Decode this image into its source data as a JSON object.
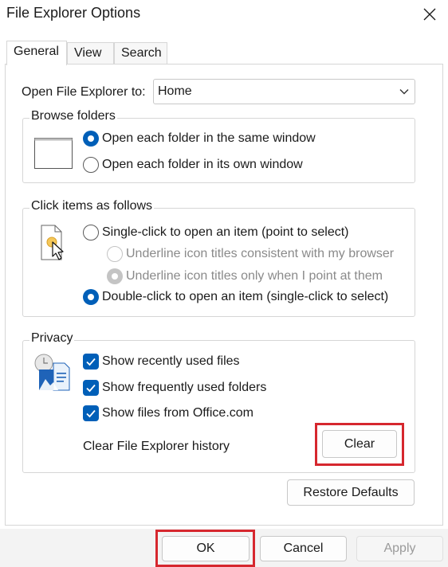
{
  "window": {
    "title": "File Explorer Options",
    "close_icon": "close-icon"
  },
  "tabs": [
    {
      "label": "General",
      "active": true
    },
    {
      "label": "View",
      "active": false
    },
    {
      "label": "Search",
      "active": false
    }
  ],
  "open_to": {
    "label": "Open File Explorer to:",
    "value": "Home"
  },
  "browse_folders": {
    "title": "Browse folders",
    "icon": "window-icon",
    "options": [
      {
        "label": "Open each folder in the same window",
        "checked": true
      },
      {
        "label": "Open each folder in its own window",
        "checked": false
      }
    ]
  },
  "click_items": {
    "title": "Click items as follows",
    "icon": "pointer-file-icon",
    "options": [
      {
        "label": "Single-click to open an item (point to select)",
        "checked": false
      },
      {
        "label": "Underline icon titles consistent with my browser",
        "checked": false,
        "disabled": true
      },
      {
        "label": "Underline icon titles only when I point at them",
        "checked": true,
        "disabled": true
      },
      {
        "label": "Double-click to open an item (single-click to select)",
        "checked": true
      }
    ]
  },
  "privacy": {
    "title": "Privacy",
    "icon": "privacy-files-icon",
    "checkboxes": [
      {
        "label": "Show recently used files",
        "checked": true
      },
      {
        "label": "Show frequently used folders",
        "checked": true
      },
      {
        "label": "Show files from Office.com",
        "checked": true
      }
    ],
    "clear_history_label": "Clear File Explorer history",
    "clear_button": "Clear"
  },
  "restore_defaults": "Restore Defaults",
  "footer": {
    "ok": "OK",
    "cancel": "Cancel",
    "apply": "Apply"
  },
  "colors": {
    "accent": "#005fb8",
    "highlight": "#d6272e"
  }
}
